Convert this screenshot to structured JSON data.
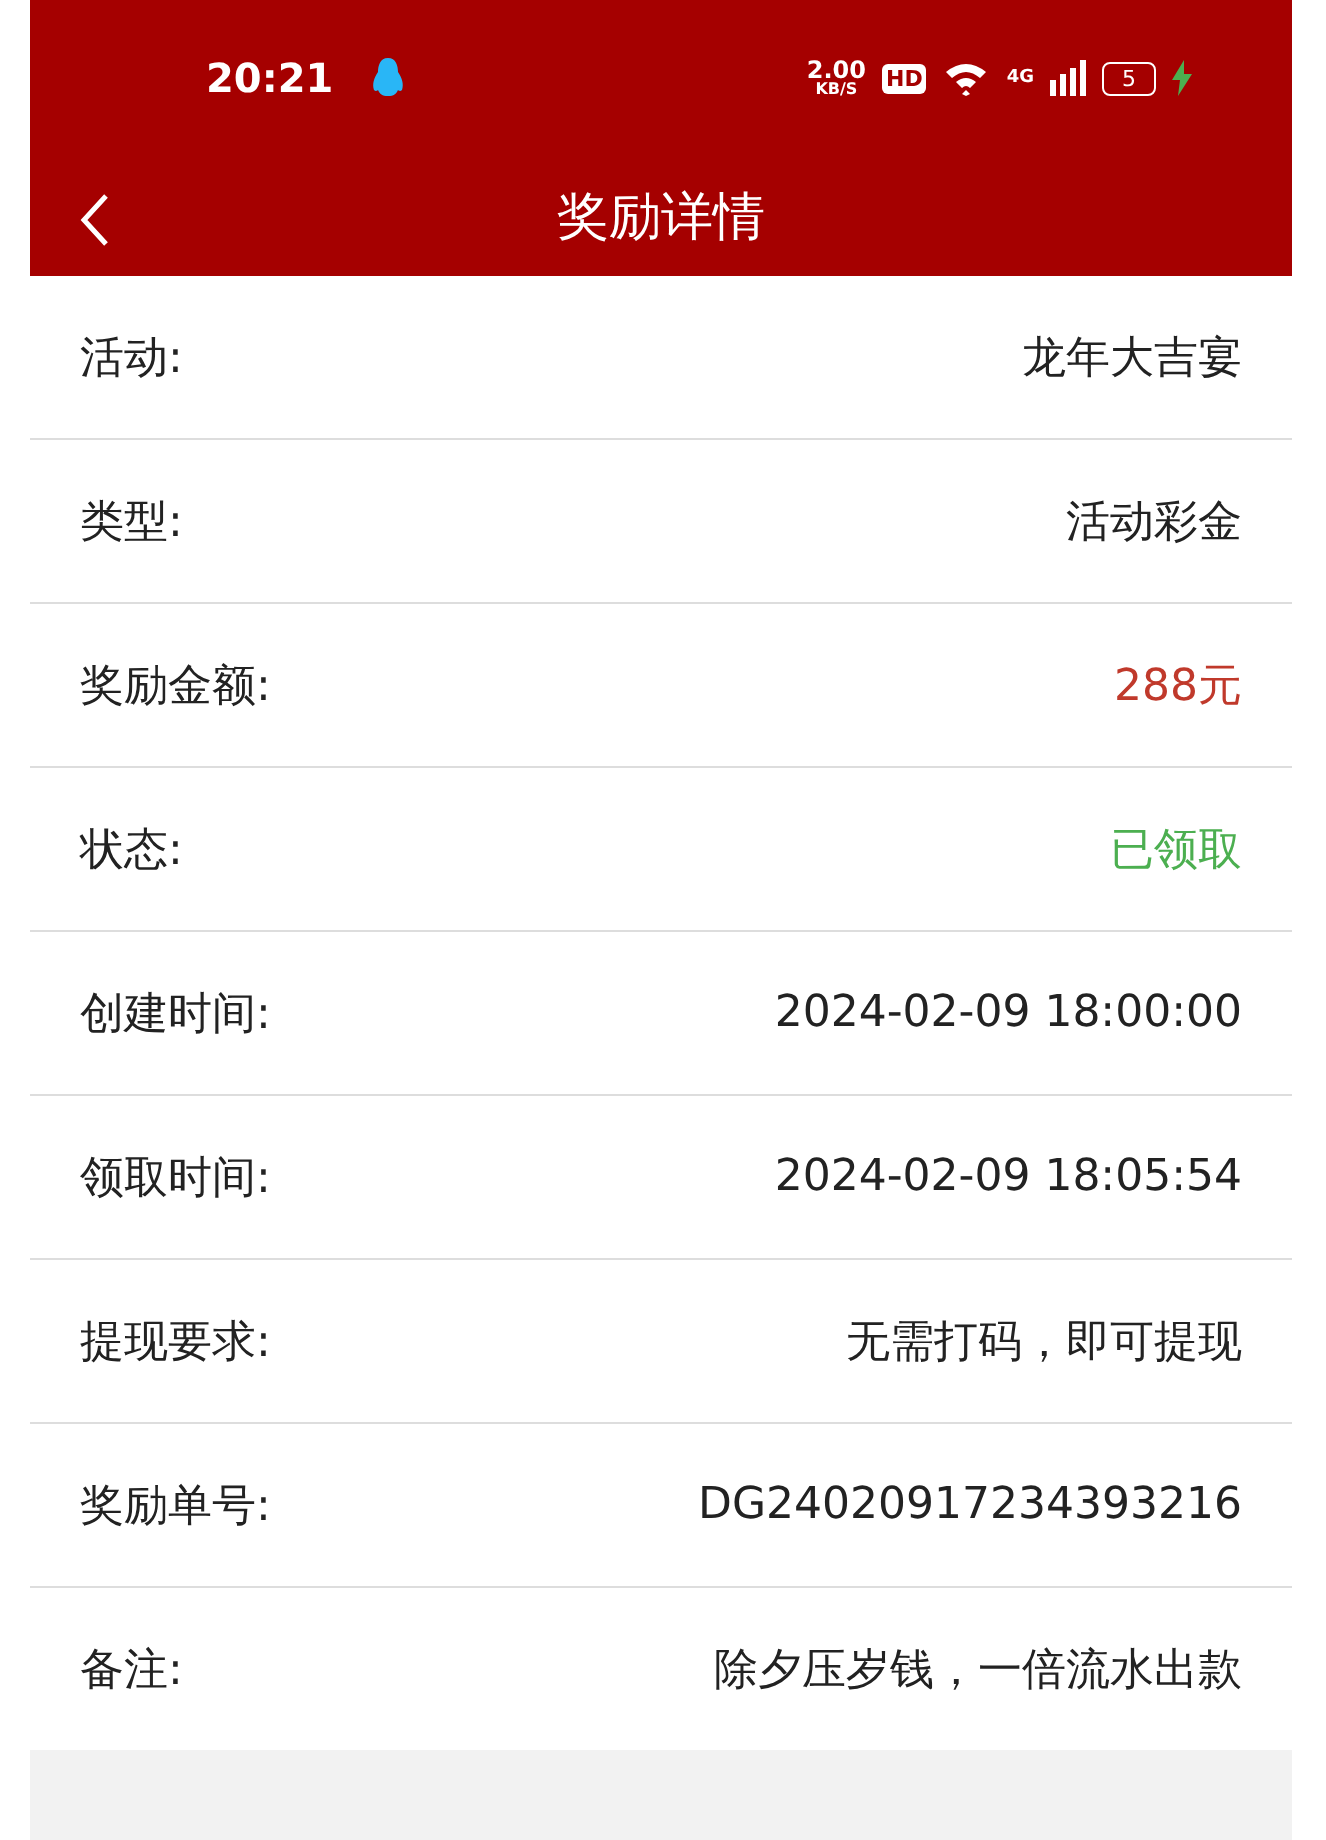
{
  "status_bar": {
    "time": "20:21",
    "speed": "2.00",
    "speed_unit": "KB/S",
    "hd": "HD",
    "network": "4G",
    "battery": "5"
  },
  "header": {
    "title": "奖励详情"
  },
  "rows": [
    {
      "label": "活动:",
      "value": "龙年大吉宴",
      "kind": "plain"
    },
    {
      "label": "类型:",
      "value": "活动彩金",
      "kind": "plain"
    },
    {
      "label": "奖励金额:",
      "value": "288元",
      "kind": "amount"
    },
    {
      "label": "状态:",
      "value": "已领取",
      "kind": "status"
    },
    {
      "label": "创建时间:",
      "value": "2024-02-09 18:00:00",
      "kind": "plain"
    },
    {
      "label": "领取时间:",
      "value": "2024-02-09 18:05:54",
      "kind": "plain"
    },
    {
      "label": "提现要求:",
      "value": "无需打码，即可提现",
      "kind": "plain"
    },
    {
      "label": "奖励单号:",
      "value": "DG24020917234393216",
      "kind": "plain"
    },
    {
      "label": "备注:",
      "value": "除夕压岁钱，一倍流水出款",
      "kind": "plain"
    }
  ]
}
